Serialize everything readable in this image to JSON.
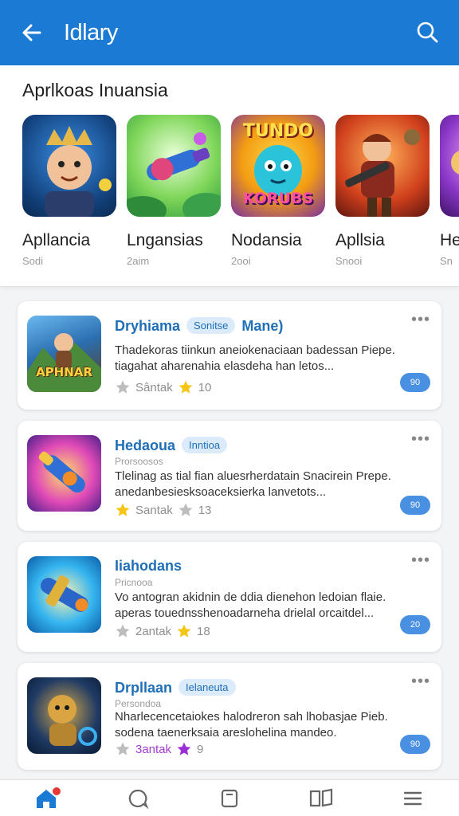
{
  "header": {
    "title": "Idlary"
  },
  "featured": {
    "title": "Aprlkoas Inuansia",
    "apps": [
      {
        "name": "Apllancia",
        "sub": "Sodi"
      },
      {
        "name": "Lngansias",
        "sub": "2aim"
      },
      {
        "name": "Nodansia",
        "sub": "2ooi"
      },
      {
        "name": "Apllsia",
        "sub": "Snooi"
      },
      {
        "name": "He",
        "sub": "Sn"
      }
    ],
    "icon3_text_top": "TUNDO",
    "icon3_text_bottom": "KORUBS"
  },
  "list": [
    {
      "name": "Dryhiama",
      "tag": "Sonitse",
      "extra": "Mane)",
      "subline": "",
      "desc1": "Thadekoras tiinkun aneiokenaciaan badessan Piepe.",
      "desc2": "tiagahat aharenahia elasdeha han letos...",
      "rating_label": "Sântak",
      "count": "10",
      "pill": "90",
      "thumb_text": "APHNAR"
    },
    {
      "name": "Hedaoua",
      "tag": "Inntioa",
      "extra": "",
      "subline": "Prorsoosos",
      "desc1": "Tlelinag as tial fian aluesrherdatain Snacirein Prepe.",
      "desc2": "anedanbesiesksoaceksierka lanvetots...",
      "rating_label": "Santak",
      "count": "13",
      "pill": "90",
      "thumb_text": ""
    },
    {
      "name": "Iiahodans",
      "tag": "",
      "extra": "",
      "subline": "Pricnooa",
      "desc1": "Vo antogran akidnin de ddia dienehon ledoian flaie.",
      "desc2": "aperas touednsshenoadarneha drielal orcaitdel...",
      "rating_label": "2antak",
      "count": "18",
      "pill": "20",
      "thumb_text": ""
    },
    {
      "name": "Drpllaan",
      "tag": "Ielaneuta",
      "extra": "",
      "subline": "Persondoa",
      "desc1": "Nharlecencetaiokes halodreron sah lhobasjae Pieb.",
      "desc2": "sodena taenerksaia areslohelina mandeo.",
      "rating_label": "3antak",
      "count": "9",
      "pill": "90",
      "thumb_text": ""
    }
  ],
  "colors": {
    "primary": "#1a7ad4",
    "accent": "#1f6fb8",
    "pill": "#4a90e2",
    "notify": "#e53935"
  },
  "icons": [
    "back-arrow-icon",
    "search-icon",
    "more-icon",
    "star-icon",
    "home-icon",
    "chat-icon",
    "tablet-icon",
    "book-icon",
    "menu-icon"
  ]
}
